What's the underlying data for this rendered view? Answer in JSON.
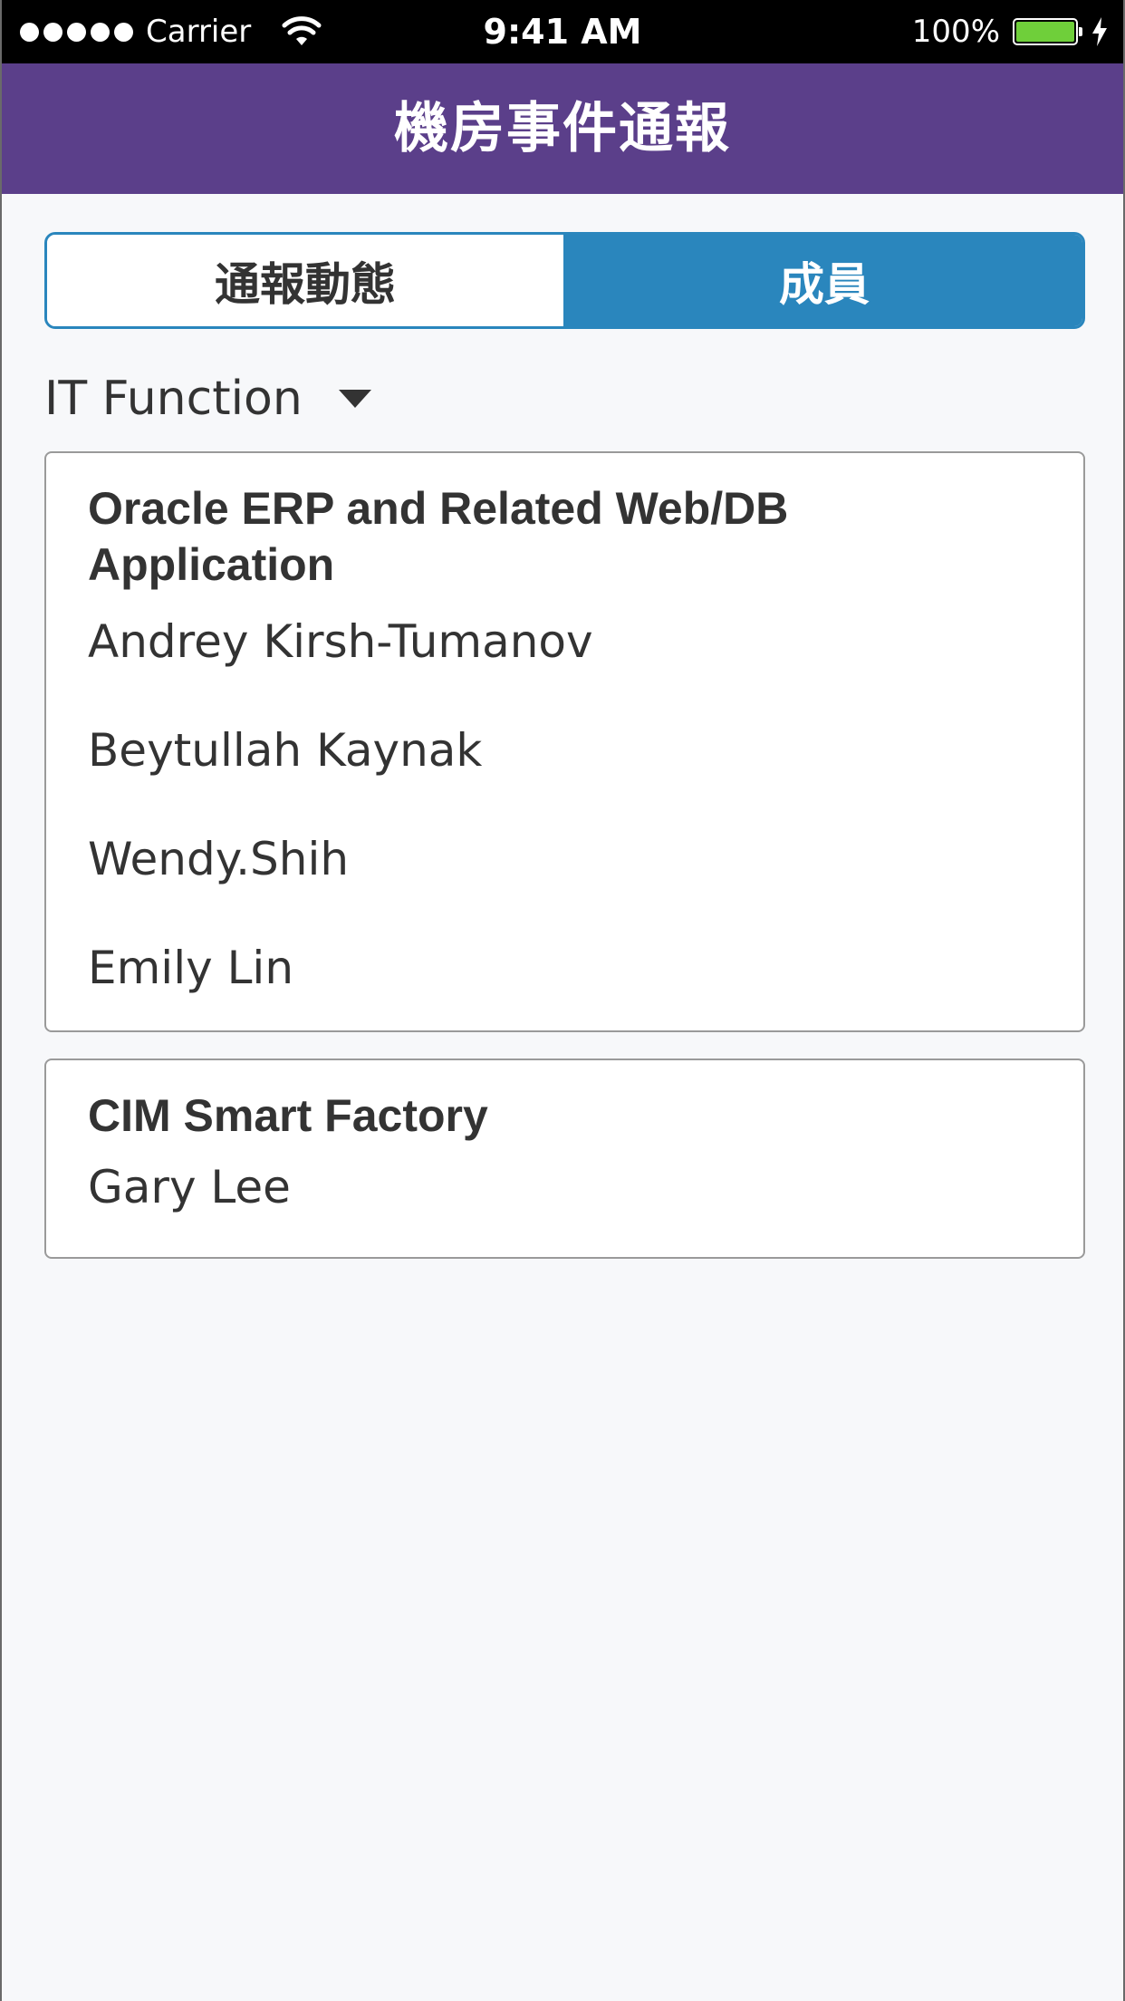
{
  "status_bar": {
    "carrier": "Carrier",
    "time": "9:41 AM",
    "battery": "100%",
    "signal_icon": "signal-dots-icon",
    "wifi_icon": "wifi-icon",
    "battery_icon": "battery-icon",
    "charging_icon": "charging-bolt-icon",
    "battery_fill_color": "#6fcf3a"
  },
  "nav": {
    "title": "機房事件通報",
    "background": "#5b3f8a"
  },
  "segments": {
    "tabs": [
      {
        "label": "通報動態",
        "selected": false
      },
      {
        "label": "成員",
        "selected": true
      }
    ],
    "accent": "#2a86bd"
  },
  "filter": {
    "label": "IT Function",
    "icon": "caret-down-icon"
  },
  "groups": [
    {
      "title": "Oracle ERP and Related Web/DB Application",
      "members": [
        "Andrey Kirsh-Tumanov",
        "Beytullah Kaynak",
        "Wendy.Shih",
        "Emily Lin"
      ]
    },
    {
      "title": "CIM Smart Factory",
      "members": [
        "Gary Lee"
      ]
    }
  ]
}
